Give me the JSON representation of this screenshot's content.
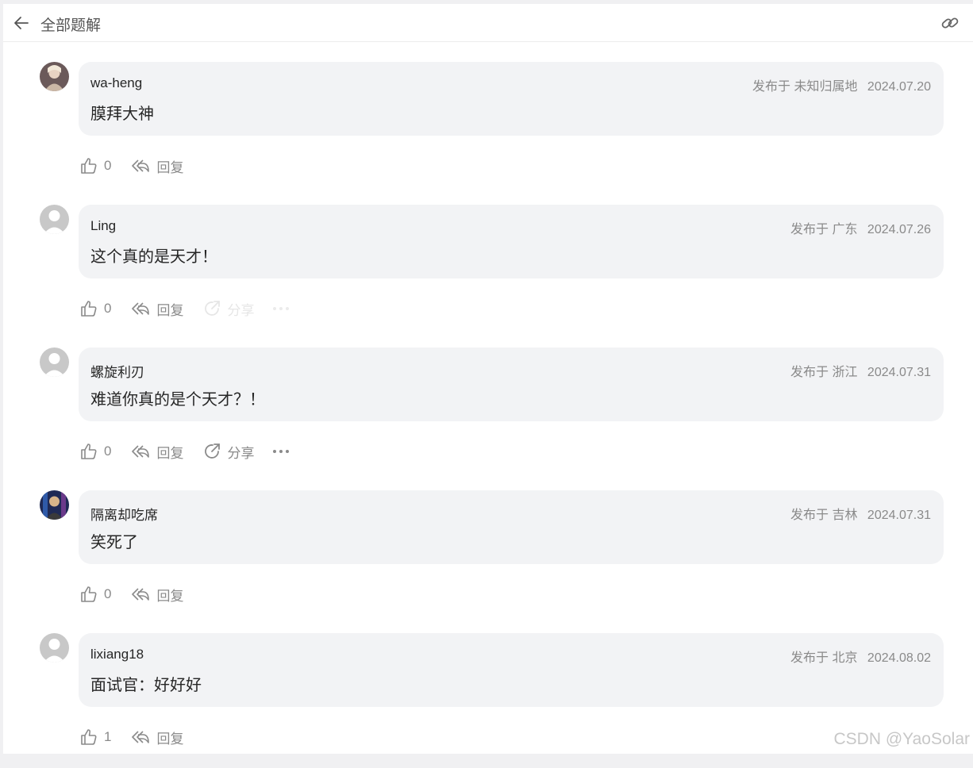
{
  "header": {
    "title": "全部题解",
    "back_icon": "arrow-left-icon",
    "link_icon": "link-icon"
  },
  "comments": [
    {
      "username": "wa-heng",
      "posted_prefix": "发布于",
      "location": "未知归属地",
      "date": "2024.07.20",
      "content": "膜拜大神",
      "likes": "0",
      "reply_label": "回复",
      "avatar": "photo"
    },
    {
      "username": "Ling",
      "posted_prefix": "发布于",
      "location": "广东",
      "date": "2024.07.26",
      "content": "这个真的是天才！",
      "likes": "0",
      "reply_label": "回复",
      "share_label": "分享",
      "avatar": "default"
    },
    {
      "username": "螺旋利刃",
      "posted_prefix": "发布于",
      "location": "浙江",
      "date": "2024.07.31",
      "content": "难道你真的是个天才？！",
      "likes": "0",
      "reply_label": "回复",
      "share_label": "分享",
      "avatar": "default"
    },
    {
      "username": "隔离却吃席",
      "posted_prefix": "发布于",
      "location": "吉林",
      "date": "2024.07.31",
      "content": "笑死了",
      "likes": "0",
      "reply_label": "回复",
      "avatar": "photo-dark"
    },
    {
      "username": "lixiang18",
      "posted_prefix": "发布于",
      "location": "北京",
      "date": "2024.08.02",
      "content": "面试官：好好好",
      "likes": "1",
      "reply_label": "回复",
      "avatar": "default"
    }
  ],
  "watermark": "CSDN @YaoSolar",
  "colors": {
    "bubble": "#f2f3f5",
    "meta": "#8a8a8a",
    "text": "#262626"
  }
}
